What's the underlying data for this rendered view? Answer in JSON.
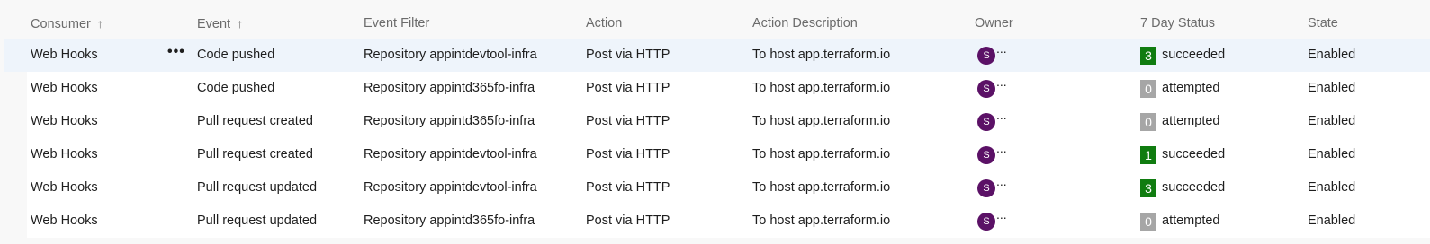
{
  "columns": {
    "consumer": "Consumer",
    "event": "Event",
    "event_filter": "Event Filter",
    "action": "Action",
    "action_description": "Action Description",
    "owner": "Owner",
    "status": "7 Day Status",
    "state": "State"
  },
  "sort_icon": "↑",
  "more_label": "•••",
  "owner_ellipsis": "...",
  "colors": {
    "avatar": "#5b1166",
    "badge_success": "#107c10",
    "badge_zero": "#a6a6a6",
    "selected_row": "#eef4fb"
  },
  "rows": [
    {
      "consumer": "Web Hooks",
      "event": "Code pushed",
      "filter": "Repository appintdevtool-infra",
      "action": "Post via HTTP",
      "description": "To host app.terraform.io",
      "owner_initial": "S",
      "count": "3",
      "status": "succeeded",
      "state": "Enabled"
    },
    {
      "consumer": "Web Hooks",
      "event": "Code pushed",
      "filter": "Repository appintd365fo-infra",
      "action": "Post via HTTP",
      "description": "To host app.terraform.io",
      "owner_initial": "S",
      "count": "0",
      "status": "attempted",
      "state": "Enabled"
    },
    {
      "consumer": "Web Hooks",
      "event": "Pull request created",
      "filter": "Repository appintd365fo-infra",
      "action": "Post via HTTP",
      "description": "To host app.terraform.io",
      "owner_initial": "S",
      "count": "0",
      "status": "attempted",
      "state": "Enabled"
    },
    {
      "consumer": "Web Hooks",
      "event": "Pull request created",
      "filter": "Repository appintdevtool-infra",
      "action": "Post via HTTP",
      "description": "To host app.terraform.io",
      "owner_initial": "S",
      "count": "1",
      "status": "succeeded",
      "state": "Enabled"
    },
    {
      "consumer": "Web Hooks",
      "event": "Pull request updated",
      "filter": "Repository appintdevtool-infra",
      "action": "Post via HTTP",
      "description": "To host app.terraform.io",
      "owner_initial": "S",
      "count": "3",
      "status": "succeeded",
      "state": "Enabled"
    },
    {
      "consumer": "Web Hooks",
      "event": "Pull request updated",
      "filter": "Repository appintd365fo-infra",
      "action": "Post via HTTP",
      "description": "To host app.terraform.io",
      "owner_initial": "S",
      "count": "0",
      "status": "attempted",
      "state": "Enabled"
    }
  ]
}
